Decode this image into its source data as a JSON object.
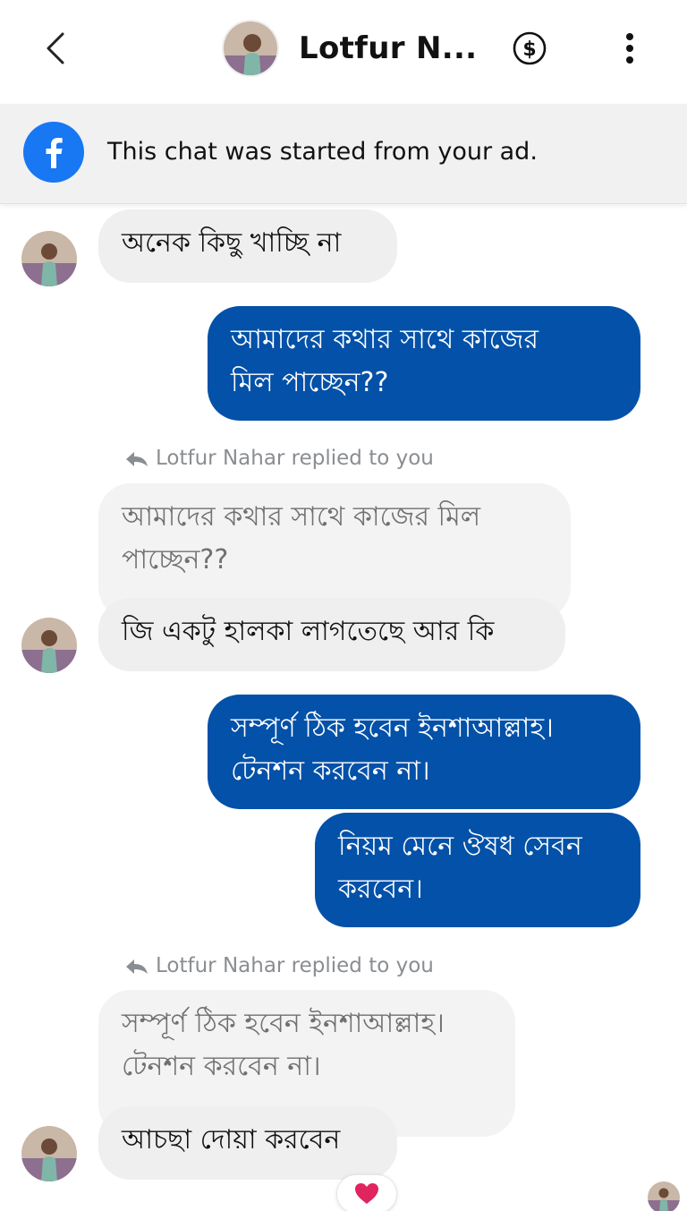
{
  "header": {
    "title": "Lotfur N...",
    "icons": {
      "back": "chevron-left-icon",
      "payment": "dollar-circle-icon",
      "more": "more-vertical-icon"
    }
  },
  "ad_banner": {
    "text": "This chat was started from your ad.",
    "icon": "facebook-icon",
    "accent": "#1877f2"
  },
  "colors": {
    "outgoing_bubble": "#0351a8",
    "incoming_bubble": "#efefef",
    "reply_label": "#8a8d91",
    "reaction_heart": "#e0245e"
  },
  "messages": [
    {
      "id": "m1",
      "direction": "in",
      "text": "অনেক কিছু খাচ্ছি না"
    },
    {
      "id": "m2",
      "direction": "out",
      "text": "আমাদের কথার সাথে কাজের\nমিল পাচ্ছেন??"
    },
    {
      "id": "m3",
      "direction": "in",
      "reply_label": "Lotfur Nahar replied to you",
      "quoted_text": "আমাদের কথার সাথে কাজের মিল\nপাচ্ছেন??",
      "text": "জি একটু হালকা লাগতেছে আর কি"
    },
    {
      "id": "m4",
      "direction": "out",
      "text": "সম্পূর্ণ ঠিক হবেন ইনশাআল্লাহ।\nটেনশন করবেন না।"
    },
    {
      "id": "m5",
      "direction": "out",
      "text": "নিয়ম মেনে ঔষধ সেবন\nকরবেন।"
    },
    {
      "id": "m6",
      "direction": "in",
      "reply_label": "Lotfur Nahar replied to you",
      "quoted_text": "সম্পূর্ণ ঠিক হবেন ইনশাআল্লাহ।\nটেনশন করবেন না।",
      "text": "আচছা দোয়া করবেন",
      "reaction": "heart-icon"
    }
  ]
}
